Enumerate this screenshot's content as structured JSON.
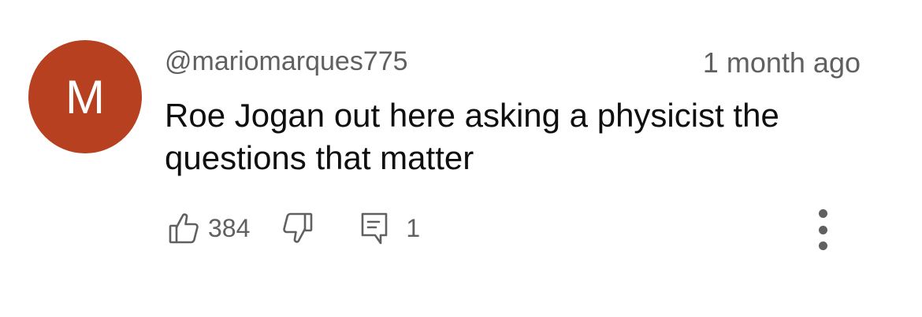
{
  "comment": {
    "avatar_initial": "M",
    "avatar_color": "#b6401f",
    "author": "@mariomarques775",
    "timestamp": "1 month ago",
    "text": "Roe Jogan out here asking a physicist the questions that matter",
    "like_count": "384",
    "reply_count": "1"
  },
  "icons": {
    "like": "thumb-up-icon",
    "dislike": "thumb-down-icon",
    "reply": "comment-icon",
    "more": "more-vertical-icon"
  }
}
